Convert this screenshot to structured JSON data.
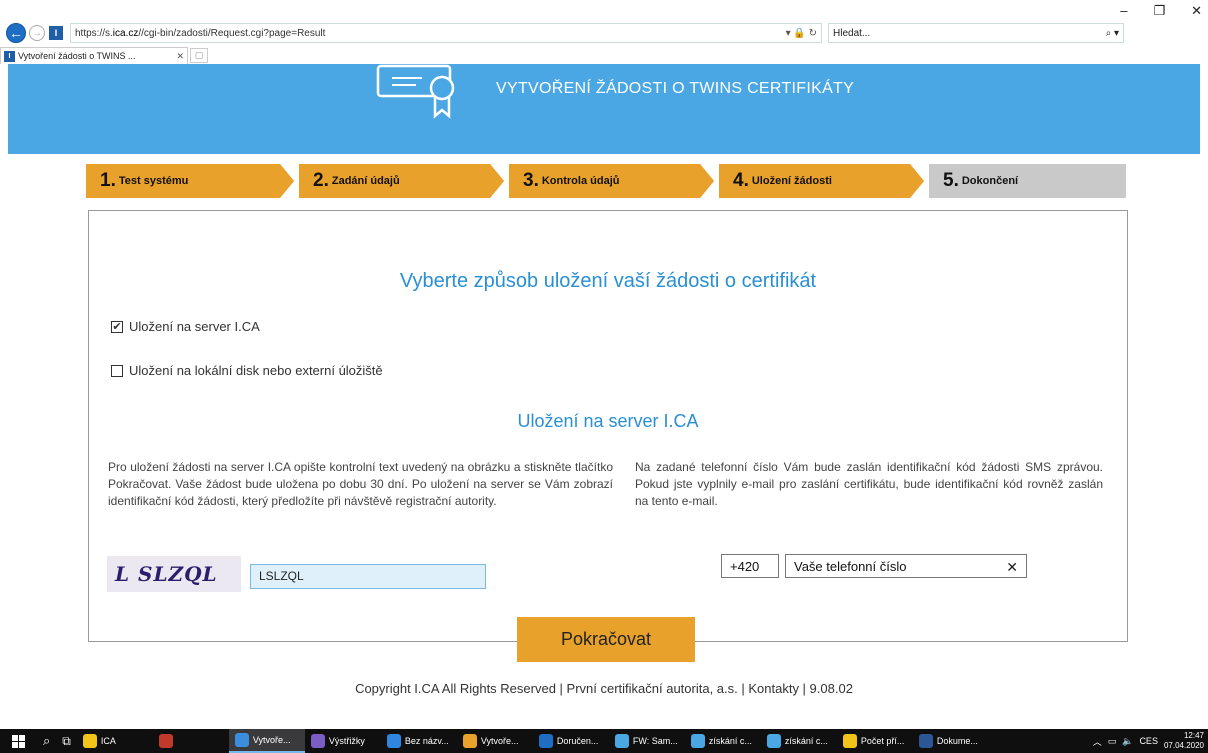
{
  "browser": {
    "url_prefix": "https://s.",
    "url_domain": "ica.cz",
    "url_path": "//cgi-bin/zadosti/Request.cgi?page=Result",
    "addr_tools": "▾ 🔒 ↻",
    "search_placeholder": "Hledat...",
    "search_tools": "⌕ ▾",
    "tab_title": "Vytvoření žádosti o TWINS ...",
    "tab_close": "✕",
    "win_minimize": "–",
    "win_restore": "❐",
    "win_close": "✕"
  },
  "hero": {
    "title": "VYTVOŘENÍ ŽÁDOSTI O TWINS CERTIFIKÁTY"
  },
  "steps": [
    {
      "num": "1.",
      "label": "Test systému"
    },
    {
      "num": "2.",
      "label": "Zadání údajů"
    },
    {
      "num": "3.",
      "label": "Kontrola údajů"
    },
    {
      "num": "4.",
      "label": "Uložení žádosti"
    },
    {
      "num": "5.",
      "label": "Dokončení"
    }
  ],
  "main": {
    "heading": "Vyberte způsob uložení vaší žádosti o certifikát",
    "option_server": "Uložení na server I.CA",
    "option_server_checked": true,
    "option_local": "Uložení na lokální disk nebo externí úložiště",
    "option_local_checked": false,
    "subheading": "Uložení na server I.CA",
    "left_text": "Pro uložení žádosti na server I.CA opište kontrolní text uvedený na obrázku a stiskněte tlačítko Pokračovat. Vaše žádost bude uložena po dobu 30 dní. Po uložení na server se Vám zobrazí identifikační kód žádosti, který předložíte při návštěvě registrační autority.",
    "right_text": "Na zadané telefonní číslo Vám bude zaslán identifikační kód žádosti SMS zprávou. Pokud jste vyplnily e-mail pro zaslání certifikátu, bude identifikační kód rovněž zaslán na tento e-mail.",
    "captcha_text": "L SLZQL",
    "captcha_input": "LSLZQL",
    "phone_prefix": "+420",
    "phone_value": "Vaše telefonní číslo",
    "phone_clear": "✕",
    "continue_label": "Pokračovat"
  },
  "footer": {
    "text": "Copyright I.CA All Rights Reserved | První certifikační autorita, a.s. | Kontakty | 9.08.02"
  },
  "taskbar": {
    "apps": [
      {
        "label": "ICA",
        "color": "#f0c419"
      },
      {
        "label": "",
        "color": "#c0392b"
      },
      {
        "label": "Vytvoře...",
        "color": "#3b8ede",
        "active": true
      },
      {
        "label": "Výstřižky",
        "color": "#7b5ec5"
      },
      {
        "label": "Bez názv...",
        "color": "#2e86de"
      },
      {
        "label": "Vytvoře...",
        "color": "#e8a12a"
      },
      {
        "label": "Doručen...",
        "color": "#1e6fc4"
      },
      {
        "label": "FW: Sam...",
        "color": "#4aa7e4"
      },
      {
        "label": "získání c...",
        "color": "#4aa7e4"
      },
      {
        "label": "získání c...",
        "color": "#4aa7e4"
      },
      {
        "label": "Počet pří...",
        "color": "#f0c419"
      },
      {
        "label": "Dokume...",
        "color": "#2b5797"
      }
    ],
    "lang": "CES",
    "time": "12:47",
    "date": "07.04.2020"
  }
}
